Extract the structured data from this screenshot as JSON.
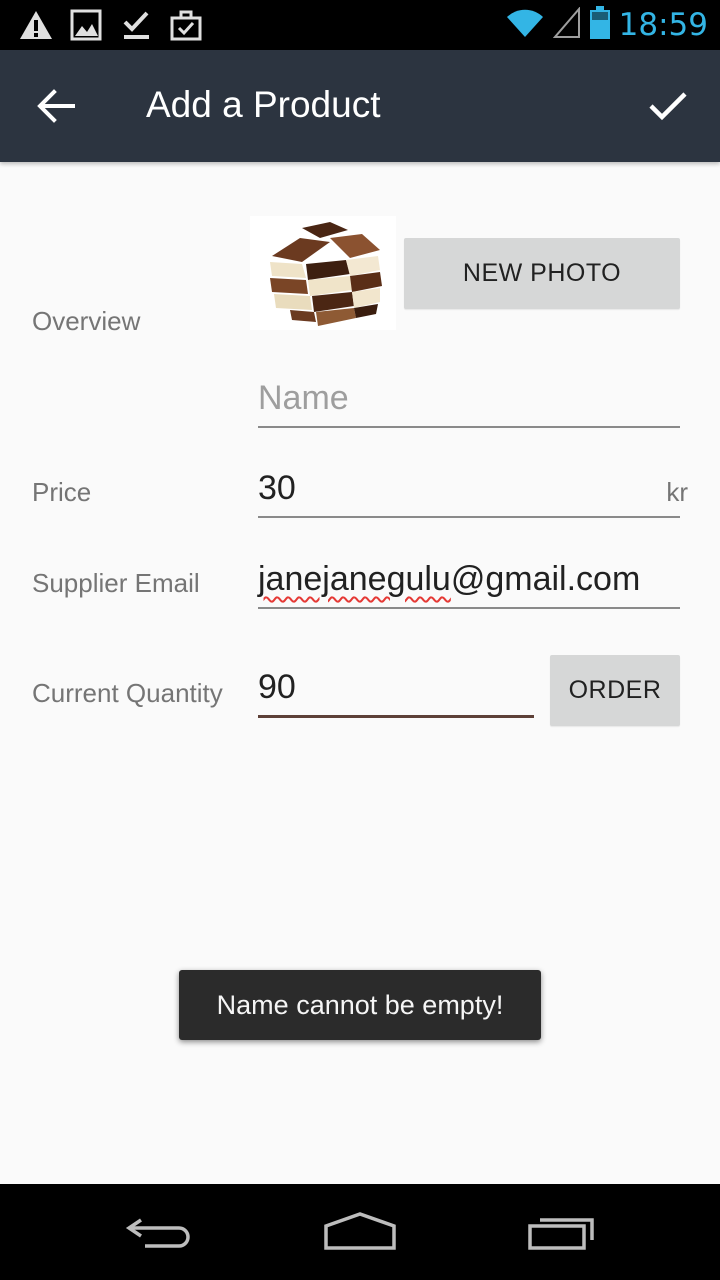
{
  "status_bar": {
    "time": "18:59",
    "icons_left": [
      "warning-icon",
      "image-icon",
      "download-done-icon",
      "briefcase-check-icon"
    ],
    "icons_right": [
      "wifi-icon",
      "signal-icon",
      "battery-icon"
    ],
    "accent": "#33b5e5"
  },
  "app_bar": {
    "title": "Add a Product",
    "background": "#2c3440"
  },
  "form": {
    "overview_label": "Overview",
    "new_photo_label": "NEW PHOTO",
    "name_placeholder": "Name",
    "name_value": "",
    "price_label": "Price",
    "price_value": "30",
    "currency": "kr",
    "supplier_email_label": "Supplier Email",
    "supplier_email_misspelled_part": "janejanegulu",
    "supplier_email_rest": "@gmail.com",
    "quantity_label": "Current Quantity",
    "quantity_value": "90",
    "order_label": "ORDER"
  },
  "toast": {
    "message": "Name cannot be empty!"
  },
  "nav_bar": {
    "icons": [
      "back-nav-icon",
      "home-nav-icon",
      "recents-nav-icon"
    ]
  }
}
